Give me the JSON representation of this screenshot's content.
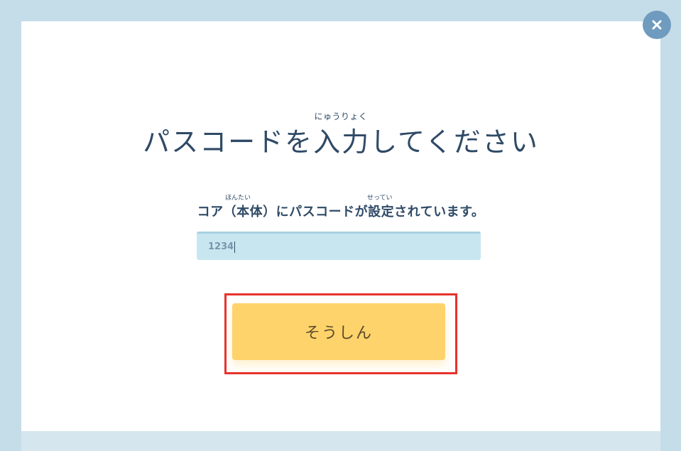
{
  "dialog": {
    "title_ruby": "にゅうりょく",
    "title": "パスコードを入力してください",
    "description_ruby_1": "ほんたい",
    "description_ruby_2": "せってい",
    "description": "コア（本体）にパスコードが設定されています。"
  },
  "passcode_input": {
    "value": "1234"
  },
  "send_button": {
    "label": "そうしん"
  },
  "close_button": {
    "icon": "close-icon"
  },
  "colors": {
    "background": "#c5dde8",
    "text": "#2f4a66",
    "button": "#ffd36b",
    "input": "#c8e6f0",
    "highlight": "#e8322a",
    "close": "#6f9bbf"
  }
}
